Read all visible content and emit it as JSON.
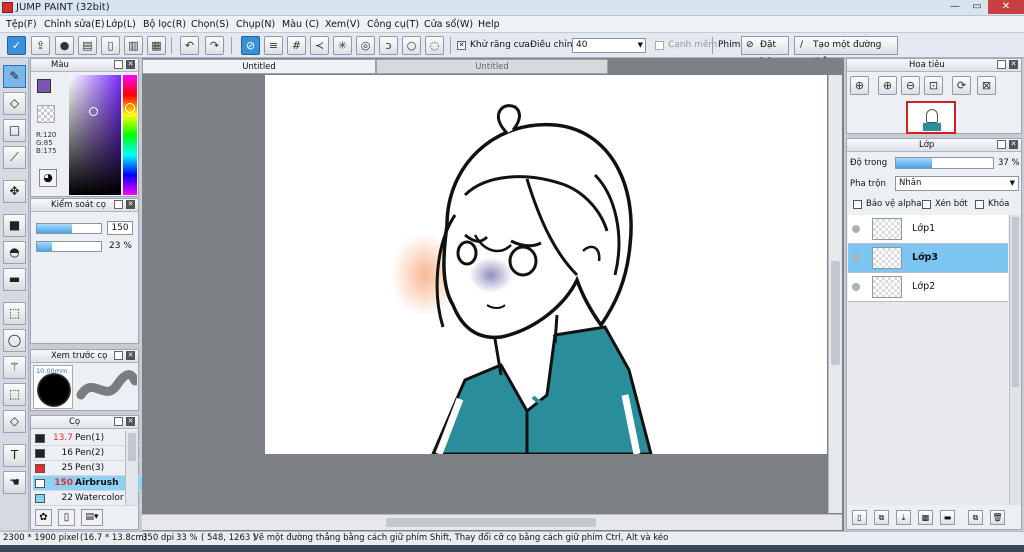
{
  "window": {
    "title": "JUMP PAINT (32bit)"
  },
  "menu": [
    "Tệp(F)",
    "Chỉnh sửa(E)",
    "Lớp(L)",
    "Bộ lọc(R)",
    "Chọn(S)",
    "Chụp(N)",
    "Màu (C)",
    "Xem(V)",
    "Công cụ(T)",
    "Cửa sổ(W)",
    "Help"
  ],
  "toolbar": {
    "antialias_label": "Khử răng cưa",
    "adjust_label": "Điều chỉnh",
    "adjust_value": "40",
    "edge_label": "Cạnh mềm",
    "key_label": "Phím",
    "reset_label": "Đặt lại",
    "straight_line_label": "Tạo một đường thẳng"
  },
  "color_panel": {
    "title": "Màu",
    "r": "R:120",
    "g": "G:85",
    "b": "B:175",
    "current_color": "#7855af"
  },
  "brush_control": {
    "title": "Kiểm soát cọ",
    "size": "150",
    "opacity": "23 %",
    "size_fraction": 0.55,
    "opacity_fraction": 0.23
  },
  "brush_preview": {
    "title": "Xem trước cọ",
    "size_text": "10.00mm"
  },
  "brush_list": {
    "title": "Cọ",
    "items": [
      {
        "size": "13.7",
        "name": "Pen(1)",
        "color": "#222222"
      },
      {
        "size": "16",
        "name": "Pen(2)",
        "color": "#222222"
      },
      {
        "size": "25",
        "name": "Pen(3)",
        "color": "#e03030"
      },
      {
        "size": "150",
        "name": "Airbrush",
        "color": "#ffffff"
      },
      {
        "size": "22",
        "name": "Watercolor (",
        "color": "#7fd4f0"
      }
    ]
  },
  "tabs": [
    "Untitled",
    "Untitled"
  ],
  "navigator": {
    "title": "Hoa tiêu"
  },
  "layers_panel": {
    "title": "Lớp",
    "opacity_label": "Độ trong",
    "opacity_value": "37 %",
    "opacity_fraction": 0.37,
    "blend_label": "Pha trộn",
    "blend_value": "Nhân",
    "protect_alpha": "Bảo vệ alpha",
    "clip": "Xén bớt",
    "lock": "Khóa",
    "layers": [
      {
        "name": "Lớp1",
        "selected": false
      },
      {
        "name": "Lớp3",
        "selected": true
      },
      {
        "name": "Lớp2",
        "selected": false
      }
    ]
  },
  "status": {
    "pixels": "2300 * 1900 pixel",
    "cm": "(16.7 * 13.8cm)",
    "dpi": "350 dpi",
    "zoom": "33 %",
    "coords": "( 548, 1263 )",
    "hint": "Vẽ một đường thẳng bằng cách giữ phím Shift, Thay đổi cỡ cọ bằng cách giữ phím Ctrl, Alt và kéo"
  }
}
